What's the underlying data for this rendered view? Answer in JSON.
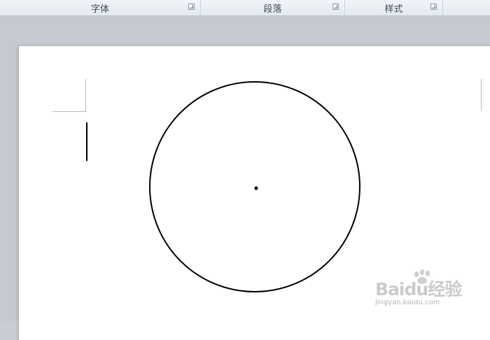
{
  "ribbon": {
    "groups": [
      {
        "label": "字体"
      },
      {
        "label": "段落"
      },
      {
        "label": "样式"
      }
    ]
  },
  "watermark": {
    "logo": "Baidu经验",
    "site": "jingyan.baidu.com"
  },
  "colors": {
    "ribbon": "#e8edf3",
    "workspace": "#c6c9cf",
    "page": "#ffffff",
    "circle_stroke": "#000000"
  }
}
